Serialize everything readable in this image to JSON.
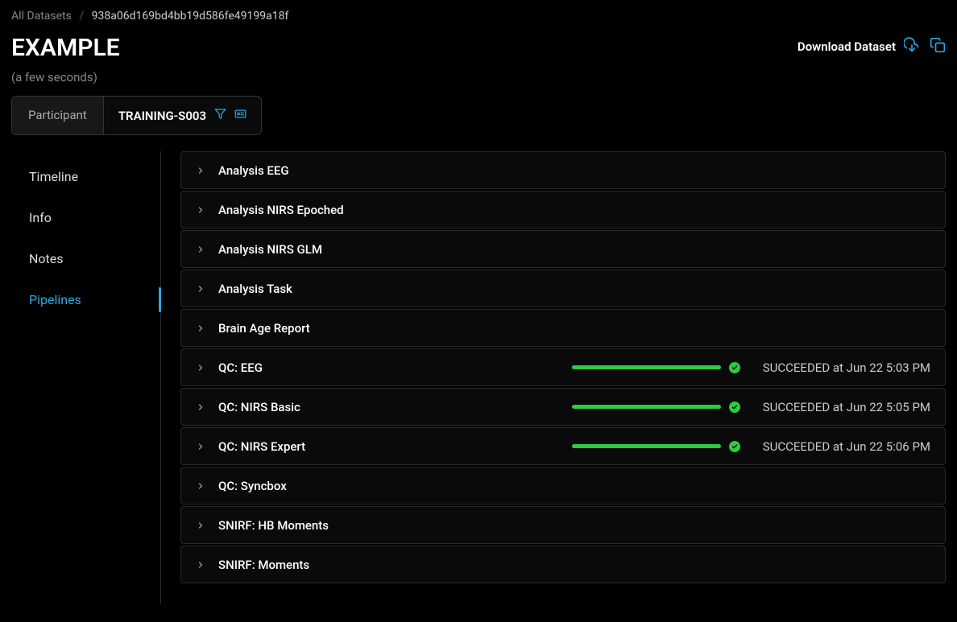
{
  "breadcrumb": {
    "root": "All Datasets",
    "current": "938a06d169bd4bb19d586fe49199a18f"
  },
  "header": {
    "title": "EXAMPLE",
    "download_label": "Download Dataset",
    "subtitle": "(a few seconds)"
  },
  "participant": {
    "label": "Participant",
    "value": "TRAINING-S003"
  },
  "sidebar": {
    "items": [
      {
        "label": "Timeline",
        "active": false
      },
      {
        "label": "Info",
        "active": false
      },
      {
        "label": "Notes",
        "active": false
      },
      {
        "label": "Pipelines",
        "active": true
      }
    ]
  },
  "pipelines": [
    {
      "name": "Analysis EEG",
      "status": "",
      "has_progress": false
    },
    {
      "name": "Analysis NIRS Epoched",
      "status": "",
      "has_progress": false
    },
    {
      "name": "Analysis NIRS GLM",
      "status": "",
      "has_progress": false
    },
    {
      "name": "Analysis Task",
      "status": "",
      "has_progress": false
    },
    {
      "name": "Brain Age Report",
      "status": "",
      "has_progress": false
    },
    {
      "name": "QC: EEG",
      "status": "SUCCEEDED at Jun 22 5:03 PM",
      "has_progress": true
    },
    {
      "name": "QC: NIRS Basic",
      "status": "SUCCEEDED at Jun 22 5:05 PM",
      "has_progress": true
    },
    {
      "name": "QC: NIRS Expert",
      "status": "SUCCEEDED at Jun 22 5:06 PM",
      "has_progress": true
    },
    {
      "name": "QC: Syncbox",
      "status": "",
      "has_progress": false
    },
    {
      "name": "SNIRF: HB Moments",
      "status": "",
      "has_progress": false
    },
    {
      "name": "SNIRF: Moments",
      "status": "",
      "has_progress": false
    }
  ],
  "colors": {
    "accent": "#29a9e0",
    "success": "#2ecc40"
  }
}
